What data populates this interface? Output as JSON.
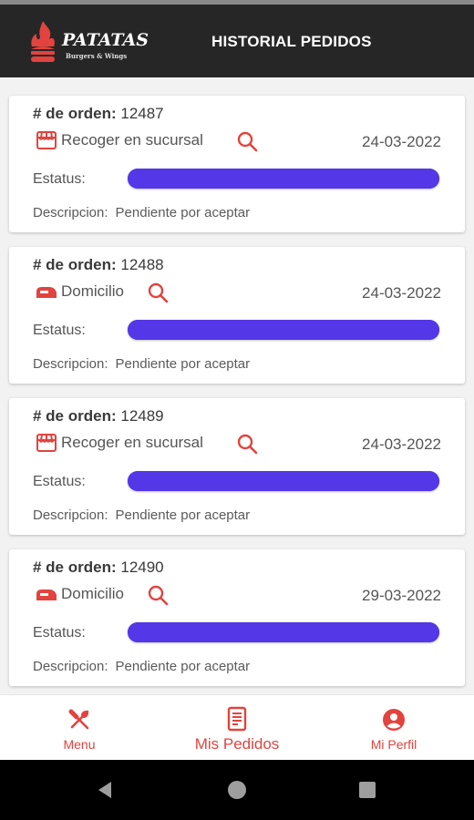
{
  "header": {
    "logo_word": "PATATAS",
    "logo_sub": "Burgers & Wings",
    "title": "HISTORIAL PEDIDOS"
  },
  "colors": {
    "accent": "#e2433e",
    "header_bg": "#262626",
    "progress": "#5437e6"
  },
  "labels": {
    "order_prefix": "# de orden:",
    "status": "Estatus:",
    "description": "Descripcion:"
  },
  "orders": [
    {
      "number": "12487",
      "type": "Recoger en sucursal",
      "type_icon": "store-icon",
      "date": "24-03-2022",
      "progress": 1.0,
      "description": "Pendiente por aceptar"
    },
    {
      "number": "12488",
      "type": "Domicilio",
      "type_icon": "delivery-scooter-icon",
      "date": "24-03-2022",
      "progress": 1.0,
      "description": "Pendiente por aceptar"
    },
    {
      "number": "12489",
      "type": "Recoger en sucursal",
      "type_icon": "store-icon",
      "date": "24-03-2022",
      "progress": 1.0,
      "description": "Pendiente por aceptar"
    },
    {
      "number": "12490",
      "type": "Domicilio",
      "type_icon": "delivery-scooter-icon",
      "date": "29-03-2022",
      "progress": 1.0,
      "description": "Pendiente por aceptar"
    }
  ],
  "nav": {
    "menu": "Menu",
    "orders": "Mis Pedidos",
    "profile": "Mi Perfil"
  }
}
